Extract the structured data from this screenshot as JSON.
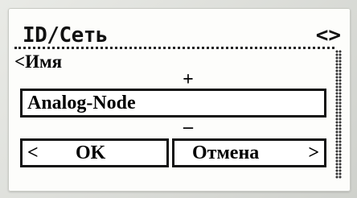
{
  "header": {
    "title": "ID/Сеть",
    "nav_arrows": "<>"
  },
  "editor": {
    "back_label": "<Имя",
    "increment_glyph": "+",
    "decrement_glyph": "–",
    "name_value": "Analog-Node"
  },
  "buttons": {
    "ok_prefix": "<",
    "ok_label": "OK",
    "cancel_label": "Отмена",
    "cancel_suffix": ">"
  }
}
